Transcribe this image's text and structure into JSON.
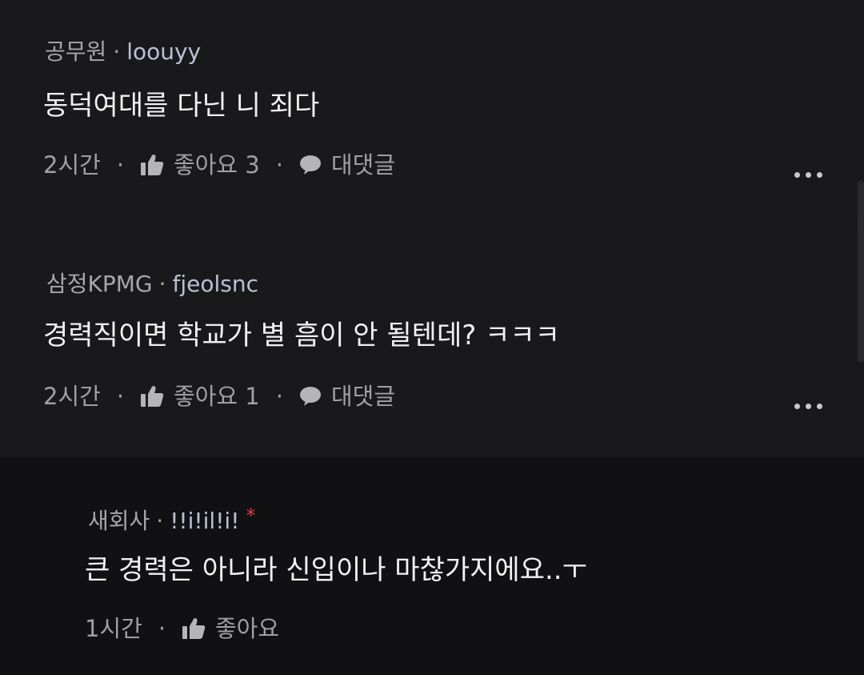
{
  "comments": [
    {
      "affiliation": "공무원",
      "separator": "·",
      "nickname": "loouyy",
      "text": "동덕여대를 다닌 니 죄다",
      "time": "2시간",
      "like_label": "좋아요 3",
      "reply_label": "대댓글"
    },
    {
      "affiliation": "삼정KPMG",
      "separator": "·",
      "nickname": "fjeolsnc",
      "text": "경력직이면 학교가 별 흠이 안 될텐데? ㅋㅋㅋ",
      "time": "2시간",
      "like_label": "좋아요 1",
      "reply_label": "대댓글"
    }
  ],
  "reply": {
    "affiliation": "새회사",
    "separator": "·",
    "nickname": "!!i!il!i!",
    "author_mark": "*",
    "text": "큰 경력은 아니라 신입이나 마찮가지에요..ㅜ",
    "time": "1시간",
    "like_label": "좋아요"
  },
  "meta_separator": "·",
  "icons": {
    "like": "thumbs-up-icon",
    "reply": "speech-bubble-icon",
    "more": "more-options-icon"
  },
  "colors": {
    "background": "#171719",
    "author_star": "#e1384a",
    "nickname": "#b9c0d6"
  }
}
